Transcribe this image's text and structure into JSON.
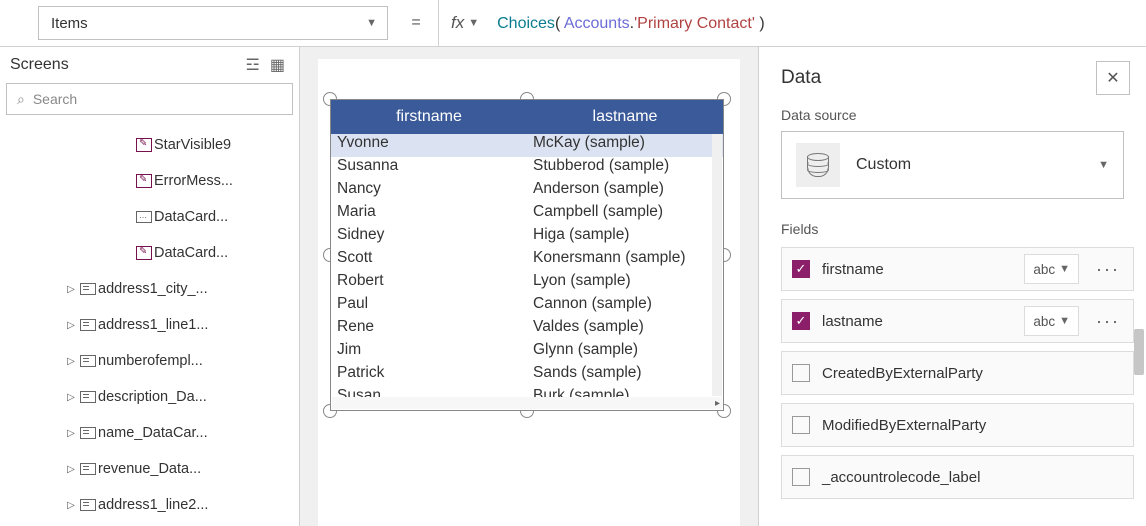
{
  "formula_bar": {
    "property": "Items",
    "fx_label": "fx",
    "formula_parts": {
      "fn": "Choices",
      "open": "( ",
      "ds": "Accounts",
      "dot": ".",
      "str": "'Primary Contact'",
      "close": " )"
    }
  },
  "tree": {
    "title": "Screens",
    "search_placeholder": "Search",
    "items": [
      {
        "indent": 2,
        "icon": "pencil",
        "label": "StarVisible9"
      },
      {
        "indent": 2,
        "icon": "pencil",
        "label": "ErrorMess..."
      },
      {
        "indent": 2,
        "icon": "dots",
        "label": "DataCard..."
      },
      {
        "indent": 2,
        "icon": "pencil",
        "label": "DataCard..."
      },
      {
        "indent": 1,
        "icon": "rect",
        "arrow": true,
        "label": "address1_city_..."
      },
      {
        "indent": 1,
        "icon": "rect",
        "arrow": true,
        "label": "address1_line1..."
      },
      {
        "indent": 1,
        "icon": "rect",
        "arrow": true,
        "label": "numberofempl..."
      },
      {
        "indent": 1,
        "icon": "rect",
        "arrow": true,
        "label": "description_Da..."
      },
      {
        "indent": 1,
        "icon": "rect",
        "arrow": true,
        "label": "name_DataCar..."
      },
      {
        "indent": 1,
        "icon": "rect",
        "arrow": true,
        "label": "revenue_Data..."
      },
      {
        "indent": 1,
        "icon": "rect",
        "arrow": true,
        "label": "address1_line2..."
      }
    ]
  },
  "datatable": {
    "headers": {
      "c1": "firstname",
      "c2": "lastname"
    },
    "rows": [
      {
        "c1": "Yvonne",
        "c2": "McKay (sample)"
      },
      {
        "c1": "Susanna",
        "c2": "Stubberod (sample)"
      },
      {
        "c1": "Nancy",
        "c2": "Anderson (sample)"
      },
      {
        "c1": "Maria",
        "c2": "Campbell (sample)"
      },
      {
        "c1": "Sidney",
        "c2": "Higa (sample)"
      },
      {
        "c1": "Scott",
        "c2": "Konersmann (sample)"
      },
      {
        "c1": "Robert",
        "c2": "Lyon (sample)"
      },
      {
        "c1": "Paul",
        "c2": "Cannon (sample)"
      },
      {
        "c1": "Rene",
        "c2": "Valdes (sample)"
      },
      {
        "c1": "Jim",
        "c2": "Glynn (sample)"
      },
      {
        "c1": "Patrick",
        "c2": "Sands (sample)"
      },
      {
        "c1": "Susan",
        "c2": "Burk (sample)"
      }
    ]
  },
  "data_pane": {
    "title": "Data",
    "ds_label": "Data source",
    "ds_name": "Custom",
    "fields_label": "Fields",
    "type_abc": "abc",
    "fields": [
      {
        "checked": true,
        "name": "firstname",
        "typed": true
      },
      {
        "checked": true,
        "name": "lastname",
        "typed": true
      },
      {
        "checked": false,
        "name": "CreatedByExternalParty",
        "typed": false
      },
      {
        "checked": false,
        "name": "ModifiedByExternalParty",
        "typed": false
      },
      {
        "checked": false,
        "name": "_accountrolecode_label",
        "typed": false
      }
    ]
  }
}
